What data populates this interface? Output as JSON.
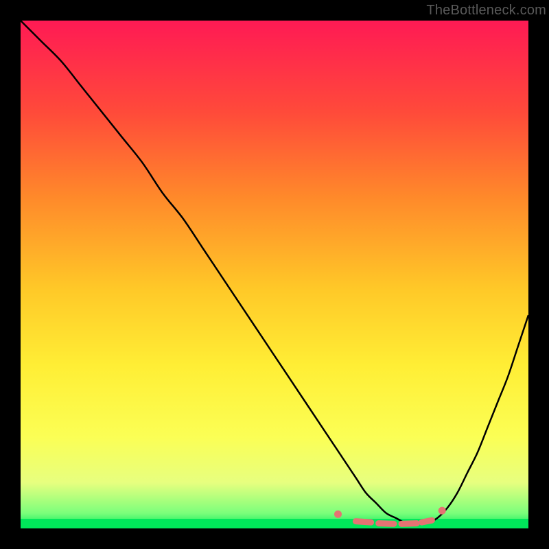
{
  "watermark": "TheBottleneck.com",
  "chart_data": {
    "type": "line",
    "title": "",
    "xlabel": "",
    "ylabel": "",
    "xlim": [
      0,
      100
    ],
    "ylim": [
      0,
      100
    ],
    "grid": false,
    "series": [
      {
        "name": "curve",
        "x": [
          0,
          4,
          8,
          12,
          16,
          20,
          24,
          28,
          32,
          36,
          40,
          44,
          48,
          52,
          56,
          60,
          62,
          64,
          66,
          68,
          70,
          72,
          74,
          76,
          78,
          80,
          82,
          84,
          86,
          88,
          90,
          92,
          94,
          96,
          98,
          100
        ],
        "values": [
          100,
          96,
          92,
          87,
          82,
          77,
          72,
          66,
          61,
          55,
          49,
          43,
          37,
          31,
          25,
          19,
          16,
          13,
          10,
          7,
          5,
          3,
          2,
          1,
          1,
          1,
          2,
          4,
          7,
          11,
          15,
          20,
          25,
          30,
          36,
          42
        ]
      }
    ],
    "markers": {
      "note": "decorative coral dots and dashes near the trough",
      "points": [
        {
          "x": 62.5,
          "y": 2.8
        },
        {
          "x": 83.0,
          "y": 3.5
        }
      ],
      "dashes": [
        {
          "x1": 66.0,
          "y1": 1.4,
          "x2": 69.0,
          "y2": 1.2
        },
        {
          "x1": 70.5,
          "y1": 1.0,
          "x2": 73.5,
          "y2": 0.9
        },
        {
          "x1": 75.0,
          "y1": 0.9,
          "x2": 78.0,
          "y2": 1.0
        },
        {
          "x1": 79.0,
          "y1": 1.2,
          "x2": 81.0,
          "y2": 1.6
        }
      ]
    }
  },
  "colors": {
    "background": "#000000",
    "curve": "#000000",
    "marker": "#e57373",
    "gradient_top": "#ff1a54",
    "gradient_mid": "#ffee35",
    "gradient_bottom": "#00e85a"
  }
}
